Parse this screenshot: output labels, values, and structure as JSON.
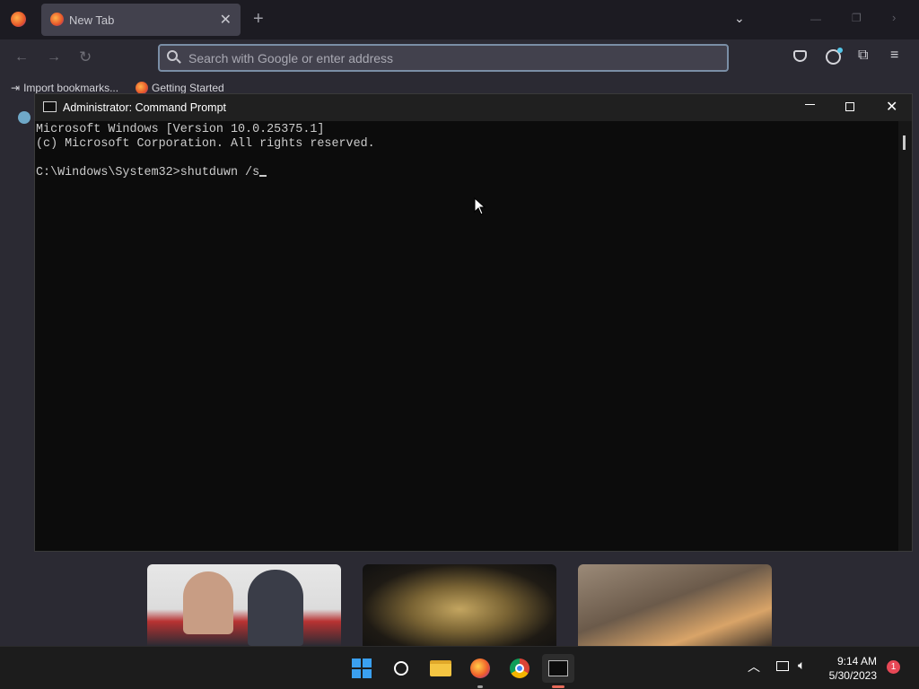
{
  "browser": {
    "tab_title": "New Tab",
    "search_placeholder": "Search with Google or enter address",
    "bookmarks": [
      "Import bookmarks...",
      "Getting Started"
    ]
  },
  "cmd": {
    "title": "Administrator: Command Prompt",
    "lines": [
      "Microsoft Windows [Version 10.0.25375.1]",
      "(c) Microsoft Corporation. All rights reserved.",
      "",
      "C:\\Windows\\System32>shutduwn /s"
    ]
  },
  "taskbar": {
    "time": "9:14 AM",
    "date": "5/30/2023",
    "notification_count": "1"
  },
  "colors": {
    "accent": "#7a8ea6",
    "cmd_bg": "#0c0c0c",
    "cmd_text": "#cccccc"
  }
}
